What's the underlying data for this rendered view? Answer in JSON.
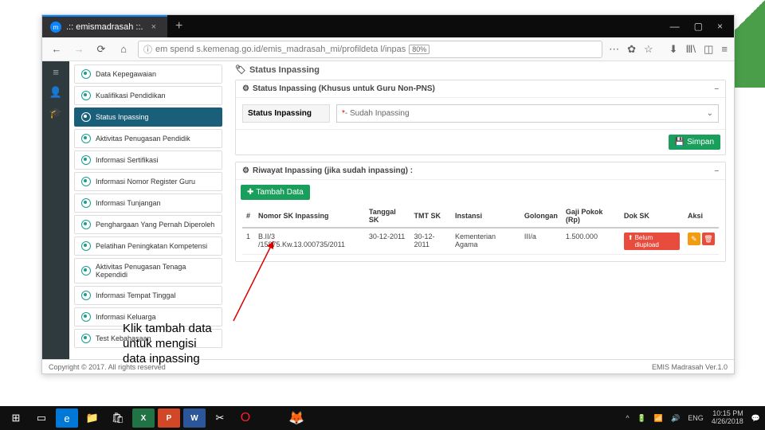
{
  "browser": {
    "tab_title": ".:: emismadrasah ::.",
    "url": "em spend s.kemenag.go.id/emis_madrasah_mi/profildeta l/inpas",
    "zoom": "80%"
  },
  "sidebar": {
    "items": [
      {
        "label": "Data Kepegawaian"
      },
      {
        "label": "Kualifikasi Pendidikan"
      },
      {
        "label": "Status Inpassing"
      },
      {
        "label": "Aktivitas Penugasan Pendidik"
      },
      {
        "label": "Informasi Sertifikasi"
      },
      {
        "label": "Informasi Nomor Register Guru"
      },
      {
        "label": "Informasi Tunjangan"
      },
      {
        "label": "Penghargaan Yang Pernah Diperoleh"
      },
      {
        "label": "Pelatihan Peningkatan Kompetensi"
      },
      {
        "label": "Aktivitas Penugasan Tenaga Kependidi"
      },
      {
        "label": "Informasi Tempat Tinggal"
      },
      {
        "label": "Informasi Keluarga"
      },
      {
        "label": "Test Kebahasaan"
      }
    ]
  },
  "main": {
    "page_title": "Status Inpassing",
    "card1": {
      "title": "Status Inpassing (Khusus untuk Guru Non-PNS)",
      "field_label": "Status Inpassing",
      "field_value": " - Sudah Inpassing",
      "save_label": "Simpan"
    },
    "card2": {
      "title": "Riwayat Inpassing (jika sudah inpassing) :",
      "add_label": "Tambah Data",
      "cols": {
        "no": "#",
        "nosk": "Nomor SK Inpassing",
        "tgl": "Tanggal SK",
        "tmt": "TMT SK",
        "instansi": "Instansi",
        "gol": "Golongan",
        "gaji": "Gaji Pokok (Rp)",
        "dok": "Dok SK",
        "aksi": "Aksi"
      },
      "row": {
        "no": "1",
        "nosk": "B.II/3 /15875.Kw.13.000735/2011",
        "tgl": "30-12-2011",
        "tmt": "30-12-2011",
        "instansi": "Kementerian Agama",
        "gol": "III/a",
        "gaji": "1.500.000",
        "dok": "Belum diupload"
      }
    }
  },
  "footer": {
    "left": "Copyright © 2017. All rights reserved",
    "right": "EMIS Madrasah Ver.1.0"
  },
  "annotation": {
    "l1": "Klik tambah data",
    "l2": "untuk mengisi",
    "l3": "data inpassing"
  },
  "taskbar": {
    "lang": "ENG",
    "time": "10:15 PM",
    "date": "4/26/2018"
  }
}
